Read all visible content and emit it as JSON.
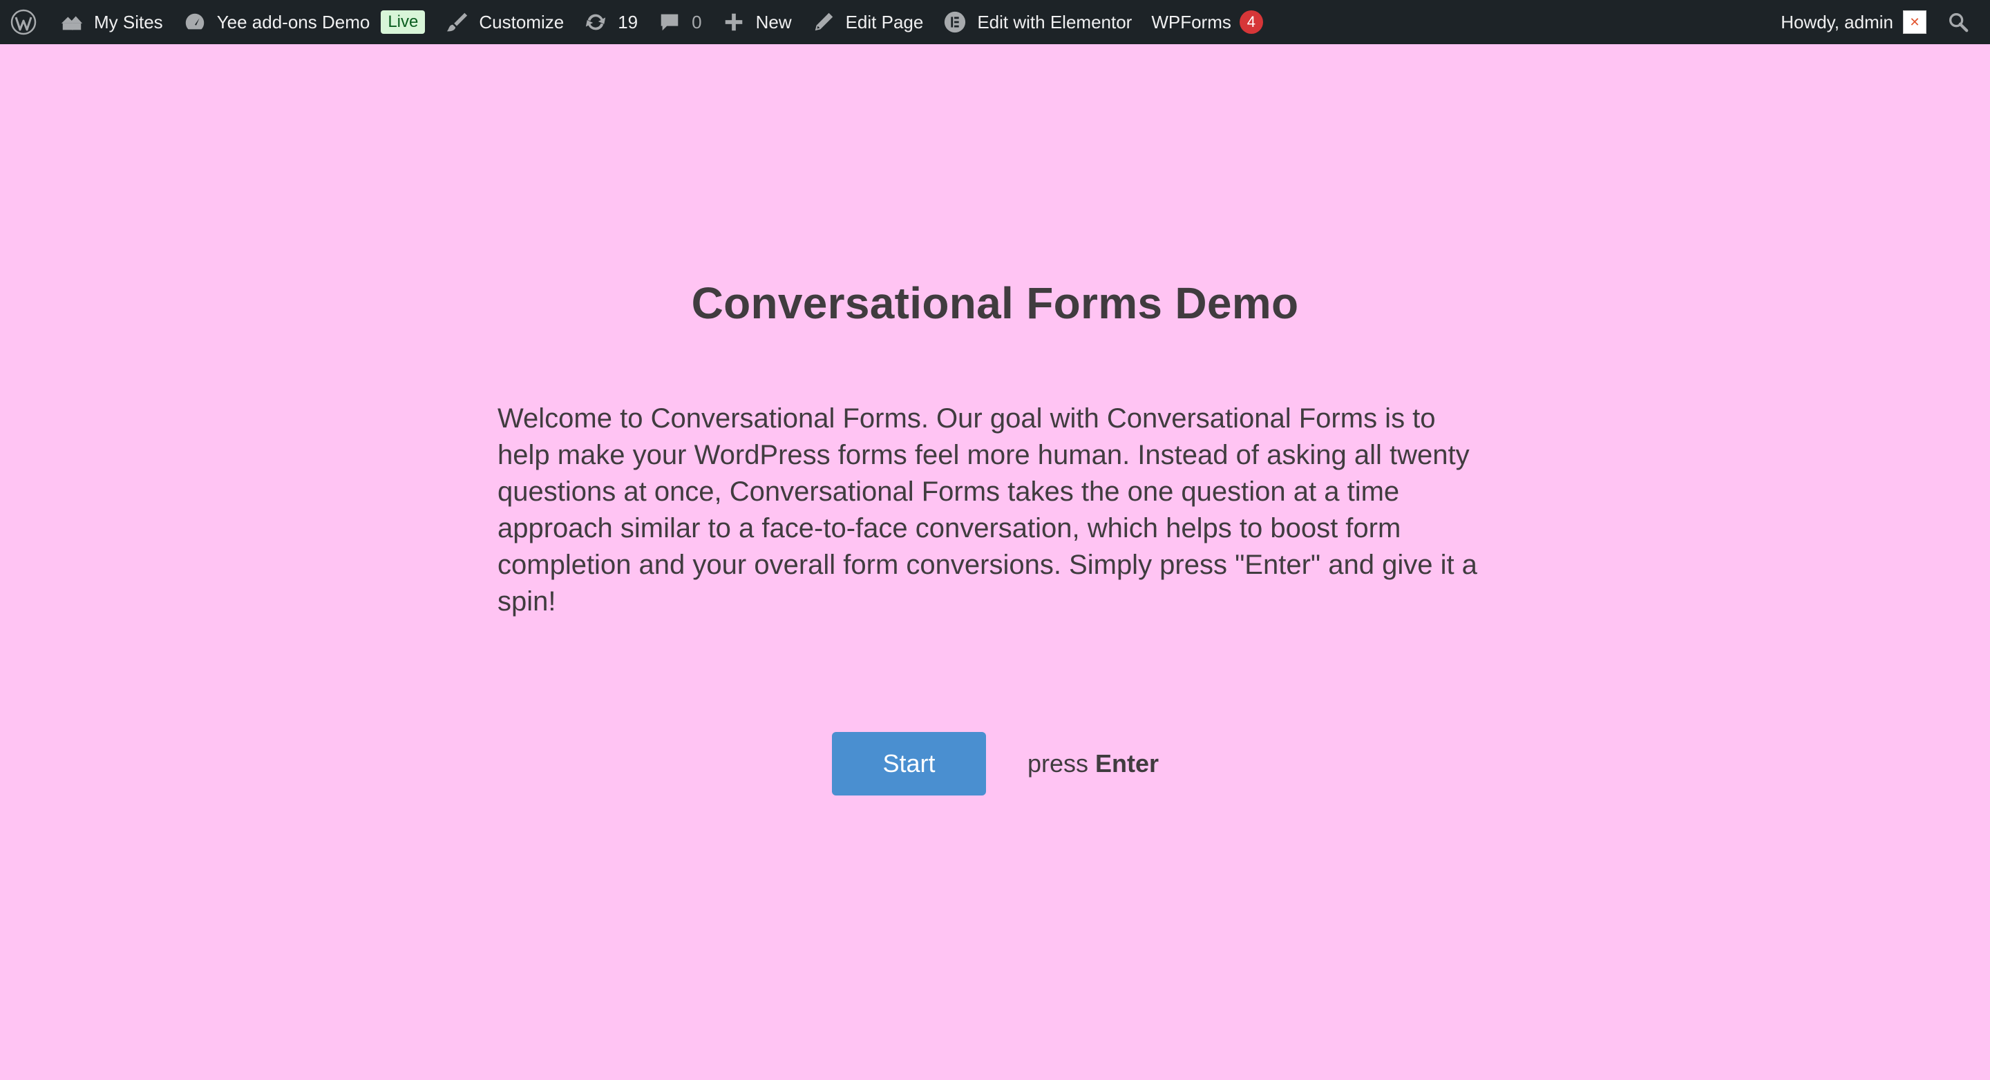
{
  "adminbar": {
    "wp_logo_icon": "wordpress-icon",
    "my_sites": "My Sites",
    "site_name": "Yee add-ons Demo",
    "live_badge": "Live",
    "customize": "Customize",
    "updates_count": "19",
    "comments_count": "0",
    "new": "New",
    "edit_page": "Edit Page",
    "edit_elementor": "Edit with Elementor",
    "wpforms": "WPForms",
    "wpforms_count": "4",
    "howdy": "Howdy, admin"
  },
  "page": {
    "background": "#ffc4f3",
    "title": "Conversational Forms Demo",
    "intro": "Welcome to Conversational Forms. Our goal with Conversational Forms is to help make your WordPress forms feel more human. Instead of asking all twenty questions at once, Conversational Forms takes the one question at a time approach similar to a face-to-face conversation, which helps to boost form completion and your overall form conversions. Simply press \"Enter\" and give it a spin!",
    "start_label": "Start",
    "press_prefix": "press",
    "press_key": "Enter"
  },
  "colors": {
    "adminbar_bg": "#1d2327",
    "button": "#4a8fd0",
    "text": "#403c3f",
    "badge_red": "#d63638"
  }
}
